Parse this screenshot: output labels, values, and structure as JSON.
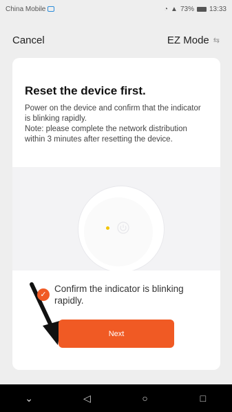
{
  "status_bar": {
    "carrier": "China Mobile",
    "status_text": "73%",
    "time": "13:33"
  },
  "header": {
    "cancel_label": "Cancel",
    "mode_label": "EZ Mode",
    "mode_icon": "switch-arrows-icon"
  },
  "card": {
    "title": "Reset the device first.",
    "description_line1": "Power on the device and confirm that the indicator is blinking rapidly.",
    "description_line2": "Note: please complete the network distribution within 3 minutes after resetting the device.",
    "confirm_label": "Confirm the indicator is blinking rapidly.",
    "confirm_checked": true,
    "next_label": "Next"
  },
  "colors": {
    "accent": "#f05a24",
    "indicator": "#f2c400"
  },
  "nav": {
    "items": [
      "collapse-icon",
      "back-icon",
      "home-icon",
      "recents-icon"
    ]
  }
}
